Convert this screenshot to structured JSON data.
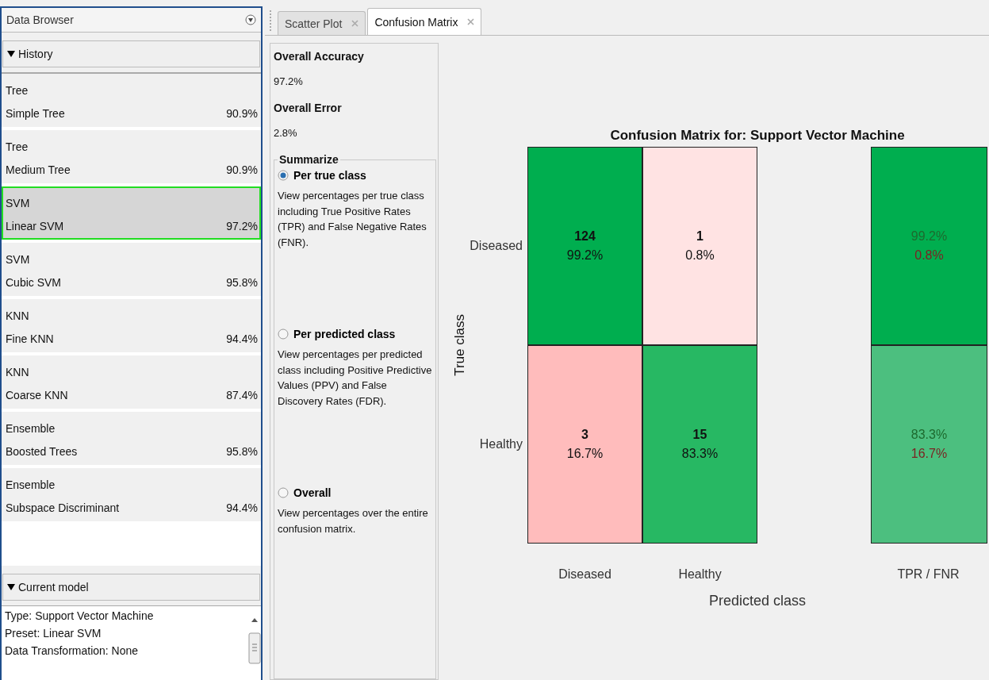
{
  "data_browser": {
    "title": "Data Browser",
    "history": {
      "label": "History",
      "expanded": true,
      "items": [
        {
          "type": "Tree",
          "name": "Simple Tree",
          "accuracy": "90.9%",
          "selected": false
        },
        {
          "type": "Tree",
          "name": "Medium Tree",
          "accuracy": "90.9%",
          "selected": false
        },
        {
          "type": "SVM",
          "name": "Linear SVM",
          "accuracy": "97.2%",
          "selected": true
        },
        {
          "type": "SVM",
          "name": "Cubic SVM",
          "accuracy": "95.8%",
          "selected": false
        },
        {
          "type": "KNN",
          "name": "Fine KNN",
          "accuracy": "94.4%",
          "selected": false
        },
        {
          "type": "KNN",
          "name": "Coarse KNN",
          "accuracy": "87.4%",
          "selected": false
        },
        {
          "type": "Ensemble",
          "name": "Boosted Trees",
          "accuracy": "95.8%",
          "selected": false
        },
        {
          "type": "Ensemble",
          "name": "Subspace Discriminant",
          "accuracy": "94.4%",
          "selected": false
        }
      ]
    },
    "current_model": {
      "label": "Current model",
      "expanded": true,
      "lines": [
        "Type: Support Vector Machine",
        "Preset: Linear SVM",
        "Data Transformation: None"
      ]
    }
  },
  "tabs": [
    {
      "label": "Scatter Plot",
      "selected": false
    },
    {
      "label": "Confusion Matrix",
      "selected": true
    }
  ],
  "options": {
    "accuracy_label": "Overall Accuracy",
    "accuracy": "97.2%",
    "error_label": "Overall Error",
    "error": "2.8%",
    "summarize": {
      "label": "Summarize",
      "options": [
        {
          "label": "Per true class",
          "description": "View percentages per true class including True Positive Rates (TPR) and False Negative Rates (FNR).",
          "selected": true
        },
        {
          "label": "Per predicted class",
          "description": "View percentages per predicted class including Positive Predictive Values (PPV) and False Discovery Rates (FDR).",
          "selected": false
        },
        {
          "label": "Overall",
          "description": "View percentages over the entire confusion matrix.",
          "selected": false
        }
      ]
    }
  },
  "matrix": {
    "title": "Confusion Matrix for: Support Vector Machine",
    "ylabel": "True class",
    "xlabel": "Predicted class",
    "rows": [
      {
        "label": "Diseased",
        "cells": [
          {
            "count": "124",
            "percent": "99.2%",
            "color": "#00ae4f"
          },
          {
            "count": "1",
            "percent": "0.8%",
            "color": "#ffe3e3"
          }
        ],
        "rate_cell": {
          "color": "#00ae4f",
          "rates": [
            {
              "kind": "tpr",
              "text": "99.2%"
            },
            {
              "kind": "fnr",
              "text": "0.8%"
            }
          ]
        }
      },
      {
        "label": "Healthy",
        "cells": [
          {
            "count": "3",
            "percent": "16.7%",
            "color": "#ffbcbc"
          },
          {
            "count": "15",
            "percent": "83.3%",
            "color": "#27b863"
          }
        ],
        "rate_cell": {
          "color": "#4cbf7f",
          "rates": [
            {
              "kind": "tpr",
              "text": "83.3%"
            },
            {
              "kind": "fnr",
              "text": "16.7%"
            }
          ]
        }
      }
    ],
    "bottom_labels": [
      "Diseased",
      "Healthy"
    ],
    "rate_bottom_label": "TPR / FNR"
  }
}
